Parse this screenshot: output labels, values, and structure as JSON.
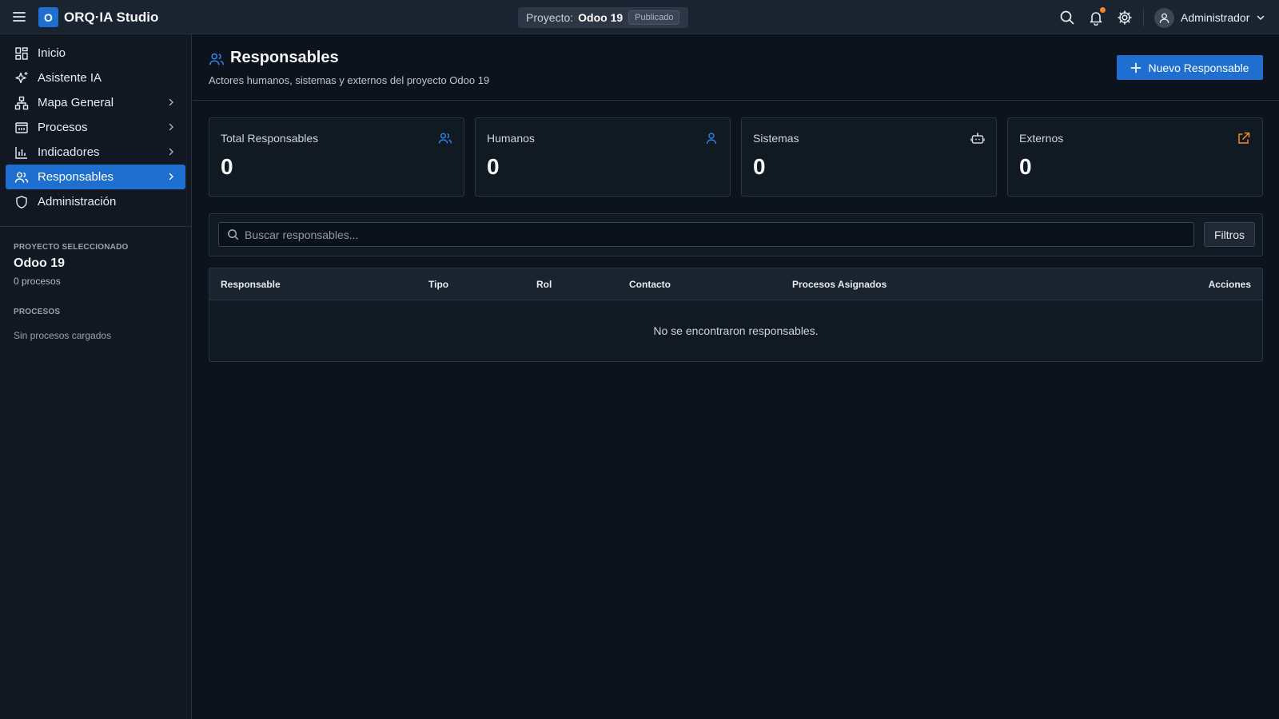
{
  "topbar": {
    "logo_letter": "O",
    "app_title": "ORQ·IA Studio",
    "project_label": "Proyecto:",
    "project_name": "Odoo 19",
    "project_status": "Publicado",
    "user_name": "Administrador",
    "notification_dot_color": "#f08a24"
  },
  "sidebar": {
    "items": [
      {
        "label": "Inicio",
        "icon": "dashboard-icon",
        "has_arrow": false,
        "active": false
      },
      {
        "label": "Asistente IA",
        "icon": "sparkles-icon",
        "has_arrow": false,
        "active": false
      },
      {
        "label": "Mapa General",
        "icon": "network-icon",
        "has_arrow": true,
        "active": false
      },
      {
        "label": "Procesos",
        "icon": "process-icon",
        "has_arrow": true,
        "active": false
      },
      {
        "label": "Indicadores",
        "icon": "bar-chart-icon",
        "has_arrow": true,
        "active": false
      },
      {
        "label": "Responsables",
        "icon": "users-icon",
        "has_arrow": true,
        "active": true
      },
      {
        "label": "Administración",
        "icon": "shield-icon",
        "has_arrow": false,
        "active": false
      }
    ],
    "selected_project_heading": "PROYECTO SELECCIONADO",
    "selected_project_name": "Odoo 19",
    "selected_project_count": "0 procesos",
    "processes_heading": "PROCESOS",
    "processes_empty": "Sin procesos cargados"
  },
  "header": {
    "title": "Responsables",
    "subtitle": "Actores humanos, sistemas y externos del proyecto Odoo 19",
    "new_button": "Nuevo Responsable"
  },
  "stats": [
    {
      "label": "Total Responsables",
      "value": "0",
      "icon": "users-icon",
      "icon_color": "#2f86e8"
    },
    {
      "label": "Humanos",
      "value": "0",
      "icon": "user-icon",
      "icon_color": "#2f86e8"
    },
    {
      "label": "Sistemas",
      "value": "0",
      "icon": "bot-icon",
      "icon_color": "#cfd6df"
    },
    {
      "label": "Externos",
      "value": "0",
      "icon": "external-link-icon",
      "icon_color": "#f08a24"
    }
  ],
  "search": {
    "placeholder": "Buscar responsables...",
    "value": "",
    "filters_label": "Filtros"
  },
  "table": {
    "columns": [
      "Responsable",
      "Tipo",
      "Rol",
      "Contacto",
      "Procesos Asignados",
      "Acciones"
    ],
    "empty_message": "No se encontraron responsables."
  },
  "colors": {
    "accent": "#1f6fd1",
    "background": "#0d131c",
    "topbar": "#1a2330",
    "sidebar": "#111821"
  }
}
